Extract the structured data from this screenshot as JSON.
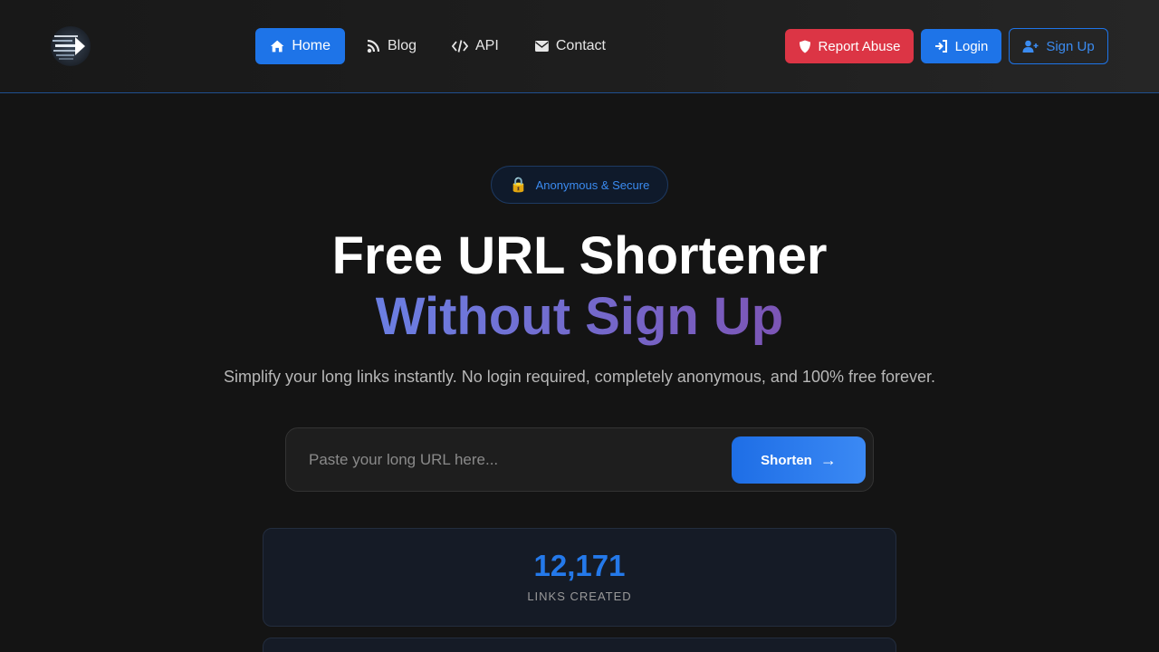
{
  "nav": {
    "items": [
      {
        "label": "Home",
        "icon": "home-icon",
        "active": true
      },
      {
        "label": "Blog",
        "icon": "blog-icon",
        "active": false
      },
      {
        "label": "API",
        "icon": "code-icon",
        "active": false
      },
      {
        "label": "Contact",
        "icon": "envelope-icon",
        "active": false
      }
    ],
    "report_label": "Report Abuse",
    "login_label": "Login",
    "signup_label": "Sign Up"
  },
  "hero": {
    "badge_icon": "🔒",
    "badge_text": "Anonymous & Secure",
    "title_line1": "Free URL Shortener",
    "title_line2": "Without Sign Up",
    "subtitle": "Simplify your long links instantly. No login required, completely anonymous, and 100% free forever."
  },
  "form": {
    "placeholder": "Paste your long URL here...",
    "value": "",
    "button_label": "Shorten",
    "button_arrow": "→"
  },
  "stats": {
    "links_value": "12,171",
    "links_label": "LINKS CREATED"
  },
  "colors": {
    "accent": "#1e74e8",
    "danger": "#dc3545",
    "background": "#141414",
    "gradient_start": "#6b7fe3",
    "gradient_end": "#7c55b6"
  }
}
